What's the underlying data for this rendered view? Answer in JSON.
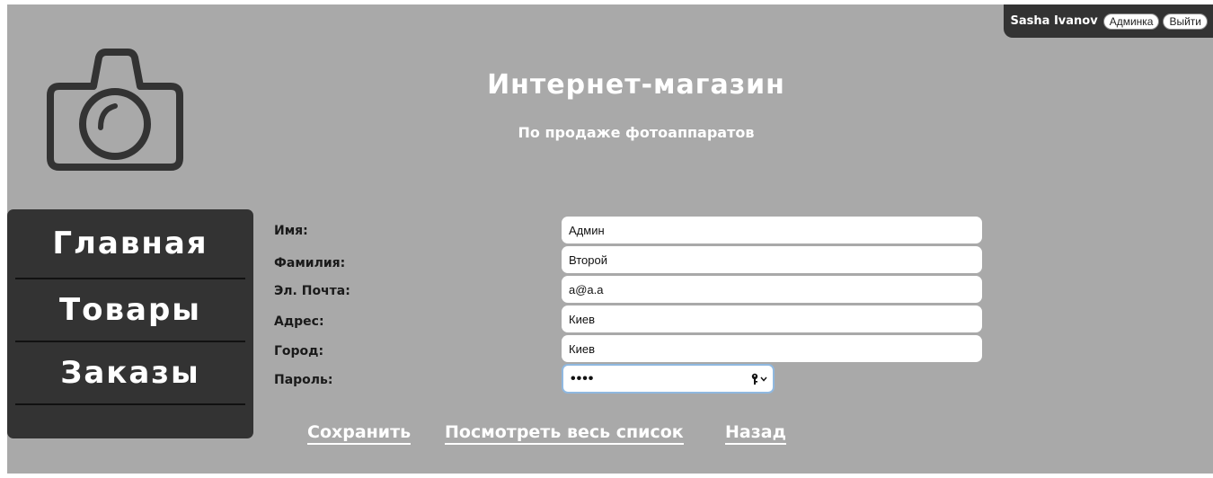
{
  "user": {
    "name": "Sasha Ivanov",
    "admin_label": "Админка",
    "logout_label": "Выйти"
  },
  "header": {
    "logo_icon": "camera-icon",
    "title": "Интернет-магазин",
    "subtitle": "По продаже фотоаппаратов"
  },
  "nav": {
    "items": [
      {
        "label": "Главная"
      },
      {
        "label": "Товары"
      },
      {
        "label": "Заказы"
      }
    ]
  },
  "form": {
    "fields": [
      {
        "label": "Имя:",
        "value": "Админ"
      },
      {
        "label": "Фамилия:",
        "value": "Второй"
      },
      {
        "label": "Эл. Почта:",
        "value": "a@a.a"
      },
      {
        "label": "Адрес:",
        "value": "Киев"
      },
      {
        "label": "Город:",
        "value": "Киев"
      },
      {
        "label": "Пароль:",
        "value": "••••"
      }
    ]
  },
  "actions": {
    "save": "Сохранить",
    "view_all": "Посмотреть весь список",
    "back": "Назад"
  },
  "colors": {
    "background": "#a9a9a9",
    "panel": "#333333",
    "text_light": "#ffffff",
    "focus_border": "#8fb8e0"
  }
}
